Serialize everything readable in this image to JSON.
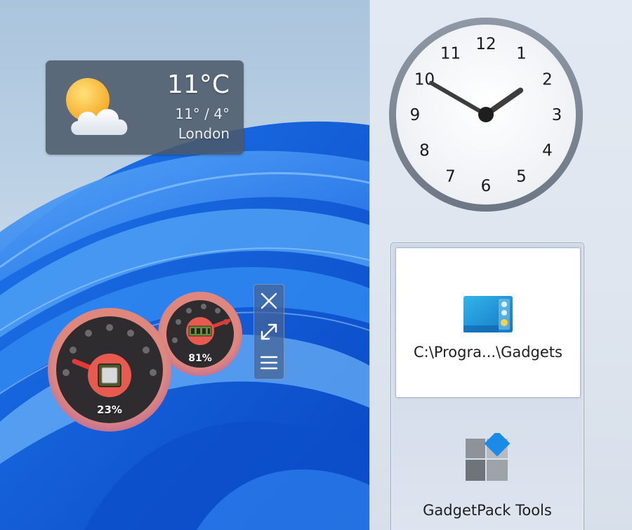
{
  "weather": {
    "temperature": "11°C",
    "range": "11° / 4°",
    "city": "London",
    "icon": "sun-cloud-icon"
  },
  "meters": {
    "cpu": {
      "label": "23%",
      "value": 0.23,
      "icon": "cpu-chip-icon"
    },
    "ram": {
      "label": "81%",
      "value": 0.81,
      "icon": "memory-module-icon"
    }
  },
  "controls": {
    "close_icon": "close-icon",
    "resize_icon": "resize-icon",
    "options_icon": "menu-icon"
  },
  "clock": {
    "hour": 1,
    "minute": 50,
    "numbers": [
      "12",
      "1",
      "2",
      "3",
      "4",
      "5",
      "6",
      "7",
      "8",
      "9",
      "10",
      "11"
    ]
  },
  "tiles": {
    "gadgets_folder": {
      "label": "C:\\Progra...\\Gadgets",
      "icon": "folder-window-icon"
    },
    "gadgetpack_tools": {
      "label": "GadgetPack Tools",
      "icon": "gadgetpack-logo-icon"
    }
  },
  "colors": {
    "meter_ring": "#e0877d",
    "meter_face": "#2f2c2f",
    "meter_needle": "#e53935",
    "meter_center": "#e85a4f",
    "ram_chip": "#6c8a3c",
    "weather_bg": "#4b5868",
    "folder_blue": "#1e9ad7",
    "gadgetpack_blue": "#1a8be6"
  }
}
